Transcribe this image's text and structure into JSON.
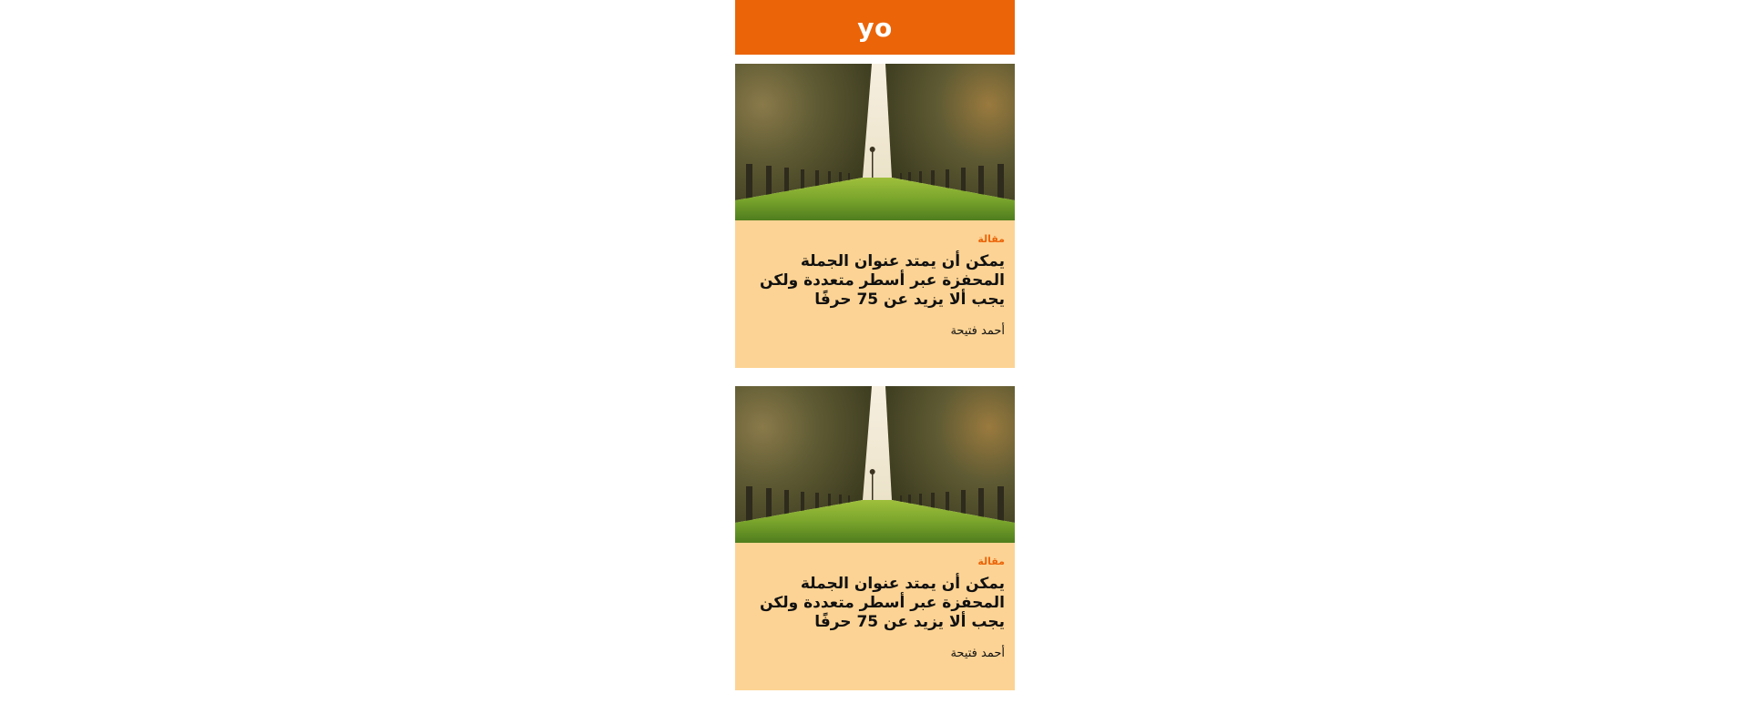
{
  "colors": {
    "brand": "#eb6408",
    "card_background": "#fcd394"
  },
  "header": {
    "logo_text": "yo"
  },
  "articles": [
    {
      "image": "palm-tree-avenue-photo",
      "category": "مقالة",
      "title": "يمكن أن يمتد عنوان الجملة المحفزة عبر أسطر متعددة ولكن يجب ألا يزيد عن 75 حرفًا",
      "author": "أحمد فتيحة"
    },
    {
      "image": "palm-tree-avenue-photo",
      "category": "مقالة",
      "title": "يمكن أن يمتد عنوان الجملة المحفزة عبر أسطر متعددة ولكن يجب ألا يزيد عن 75 حرفًا",
      "author": "أحمد فتيحة"
    }
  ]
}
